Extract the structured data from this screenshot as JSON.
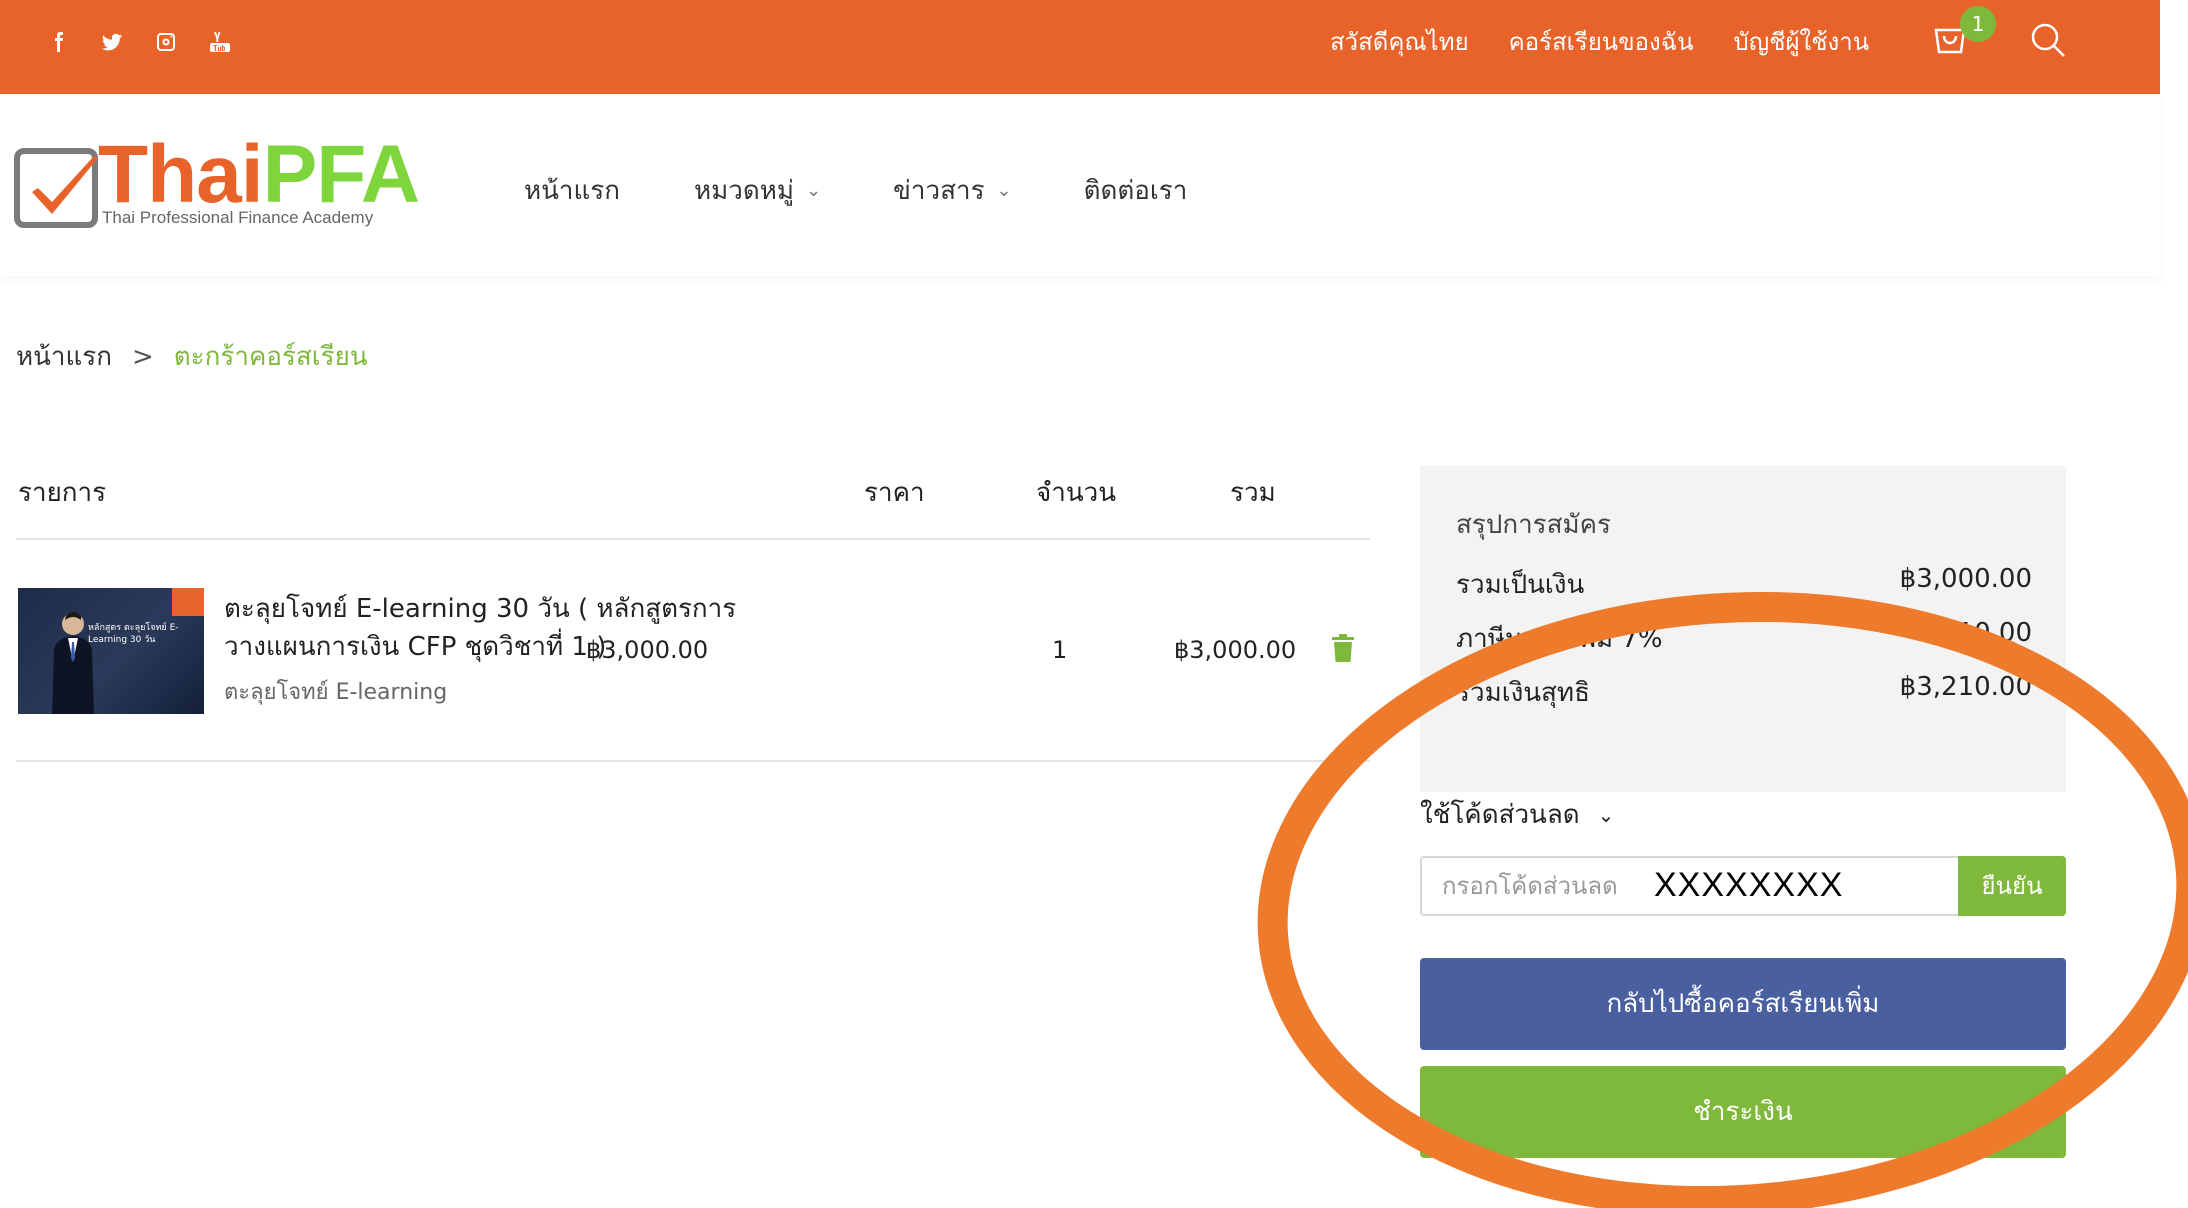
{
  "topbar": {
    "social_icons": [
      "facebook-icon",
      "twitter-icon",
      "instagram-icon",
      "youtube-icon"
    ],
    "greeting": "สวัสดีคุณไทย",
    "my_courses": "คอร์สเรียนของฉัน",
    "account": "บัญชีผู้ใช้งาน",
    "cart_count": "1",
    "bg_color": "#e8632a"
  },
  "header": {
    "logo_thai": "Thai",
    "logo_pfa": "PFA",
    "logo_tagline": "Thai Professional Finance Academy",
    "nav": {
      "home": "หน้าแรก",
      "categories": "หมวดหมู่",
      "news": "ข่าวสาร",
      "contact": "ติดต่อเรา"
    }
  },
  "breadcrumb": {
    "home": "หน้าแรก",
    "current": "ตะกร้าคอร์สเรียน"
  },
  "cart": {
    "columns": {
      "item": "รายการ",
      "price": "ราคา",
      "quantity": "จำนวน",
      "total": "รวม"
    },
    "items": [
      {
        "title": "ตะลุยโจทย์ E-learning 30 วัน ( หลักสูตรการวางแผนการเงิน CFP ชุดวิชาที่ 1 )",
        "category": "ตะลุยโจทย์ E-learning",
        "price": "฿3,000.00",
        "quantity": "1",
        "total": "฿3,000.00",
        "thumb_title": "หลักสูตร ตะลุยโจทย์ E-Learning 30 วัน"
      }
    ]
  },
  "summary": {
    "title": "สรุปการสมัคร",
    "subtotal_label": "รวมเป็นเงิน",
    "subtotal_value": "฿3,000.00",
    "vat_label": "ภาษีมูลค่าเพิ่ม 7%",
    "vat_value": "฿210.00",
    "net_label": "รวมเงินสุทธิ",
    "net_value": "฿3,210.00"
  },
  "coupon": {
    "toggle_label": "ใช้โค้ดส่วนลด",
    "placeholder": "กรอกโค้ดส่วนลด",
    "value": "XXXXXXXX",
    "confirm_label": "ยืนยัน"
  },
  "actions": {
    "back_label": "กลับไปซื้อคอร์สเรียนเพิ่ม",
    "pay_label": "ชำระเงิน"
  },
  "colors": {
    "orange": "#e8632a",
    "green": "#7fb93c",
    "blue": "#4a5fa0",
    "annotation": "#ee7a2c"
  }
}
